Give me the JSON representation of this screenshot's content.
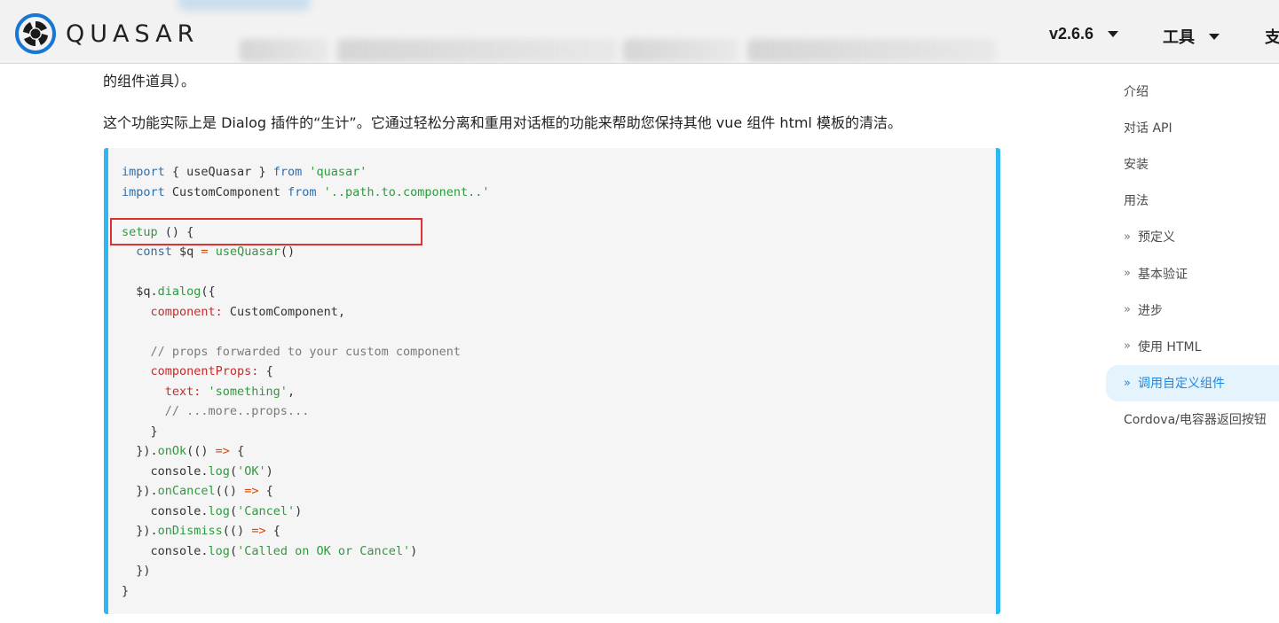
{
  "header": {
    "brand": "QUASAR",
    "version": "v2.6.6",
    "tools_label": "工具",
    "support_label_partial": "支"
  },
  "content": {
    "para_top": "的组件道具）。",
    "para_main": "这个功能实际上是 Dialog 插件的“生计”。它通过轻松分离和重用对话框的功能来帮助您保持其他 vue 组件 html 模板的清洁。"
  },
  "code": {
    "l1_kw": "import",
    "l1_mid": " { useQuasar } ",
    "l1_from": "from",
    "l1_str": " 'quasar'",
    "l2_kw": "import",
    "l2_mid": " CustomComponent ",
    "l2_from": "from",
    "l2_str": " '..path.to.component..'",
    "l4_fn": "setup",
    "l4_rest": " () {",
    "l5_kw": "  const",
    "l5_var": " $q ",
    "l5_op": "=",
    "l5_fn": " useQuasar",
    "l5_rest": "()",
    "l7_a": "  $q.",
    "l7_fn": "dialog",
    "l7_b": "({",
    "l8_prop": "    component:",
    "l8_rest": " CustomComponent,",
    "l10_cm": "    // props forwarded to your custom component",
    "l11_prop": "    componentProps:",
    "l11_rest": " {",
    "l12_prop": "      text:",
    "l12_str": " 'something'",
    "l12_rest": ",",
    "l13_cm": "      // ...more..props...",
    "l14": "    }",
    "l15_a": "  }).",
    "l15_fn": "onOk",
    "l15_b": "(() ",
    "l15_op": "=>",
    "l15_c": " {",
    "l16_a": "    console.",
    "l16_fn": "log",
    "l16_b": "(",
    "l16_str": "'OK'",
    "l16_c": ")",
    "l17_a": "  }).",
    "l17_fn": "onCancel",
    "l17_b": "(() ",
    "l17_op": "=>",
    "l17_c": " {",
    "l18_a": "    console.",
    "l18_fn": "log",
    "l18_b": "(",
    "l18_str": "'Cancel'",
    "l18_c": ")",
    "l19_a": "  }).",
    "l19_fn": "onDismiss",
    "l19_b": "(() ",
    "l19_op": "=>",
    "l19_c": " {",
    "l20_a": "    console.",
    "l20_fn": "log",
    "l20_b": "(",
    "l20_str": "'Called on OK or Cancel'",
    "l20_c": ")",
    "l21": "  })",
    "l22": "}"
  },
  "toc": {
    "items": [
      {
        "label": "介绍"
      },
      {
        "label": "对话 API"
      },
      {
        "label": "安装"
      },
      {
        "label": "用法"
      },
      {
        "label": "预定义"
      },
      {
        "label": "基本验证"
      },
      {
        "label": "进步"
      },
      {
        "label": "使用 HTML"
      },
      {
        "label": "调用自定义组件"
      },
      {
        "label": "Cordova/电容器返回按钮"
      }
    ],
    "chevron": "»"
  },
  "colors": {
    "accent": "#2db7f5",
    "active_bg": "#e5f3fc",
    "active_text": "#1e88e5",
    "highlight": "#e03131"
  }
}
